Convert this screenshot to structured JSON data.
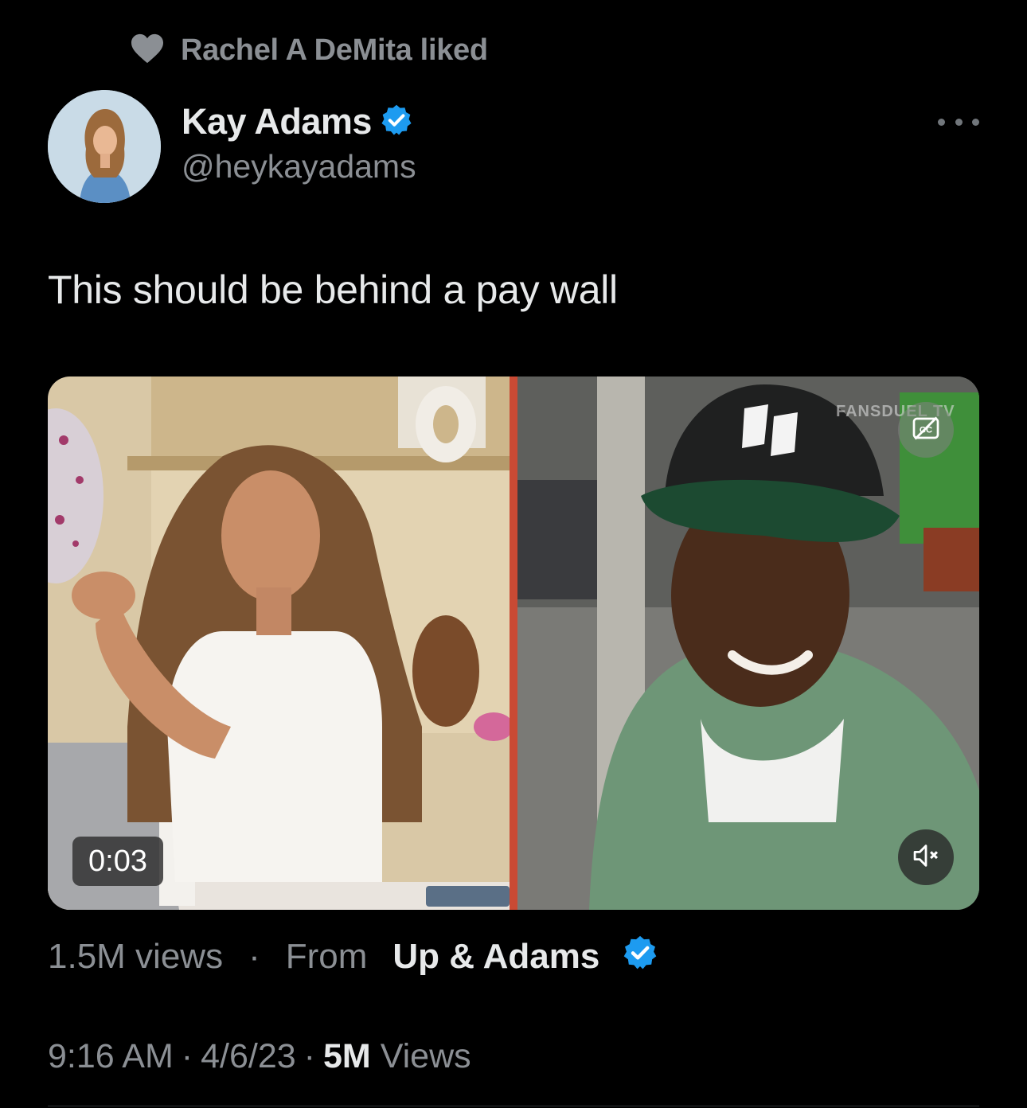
{
  "social_context": {
    "icon": "heart-icon",
    "text": "Rachel A DeMita liked"
  },
  "author": {
    "name": "Kay Adams",
    "handle": "@heykayadams",
    "verified": true,
    "verified_color": "#1d9bf0"
  },
  "more_icon": "more-options-icon",
  "tweet": {
    "text": "This should be behind a pay wall"
  },
  "media": {
    "duration": "0:03",
    "watermark": "FANSDUEL TV",
    "cc_icon": "closed-captions-off-icon",
    "mute_icon": "volume-muted-icon"
  },
  "media_footer": {
    "views": "1.5M views",
    "separator": "·",
    "from_label": "From",
    "source_name": "Up & Adams",
    "source_verified": true
  },
  "meta": {
    "time": "9:16 AM",
    "separator": "·",
    "date": "4/6/23",
    "views_count": "5M",
    "views_label": "Views"
  }
}
